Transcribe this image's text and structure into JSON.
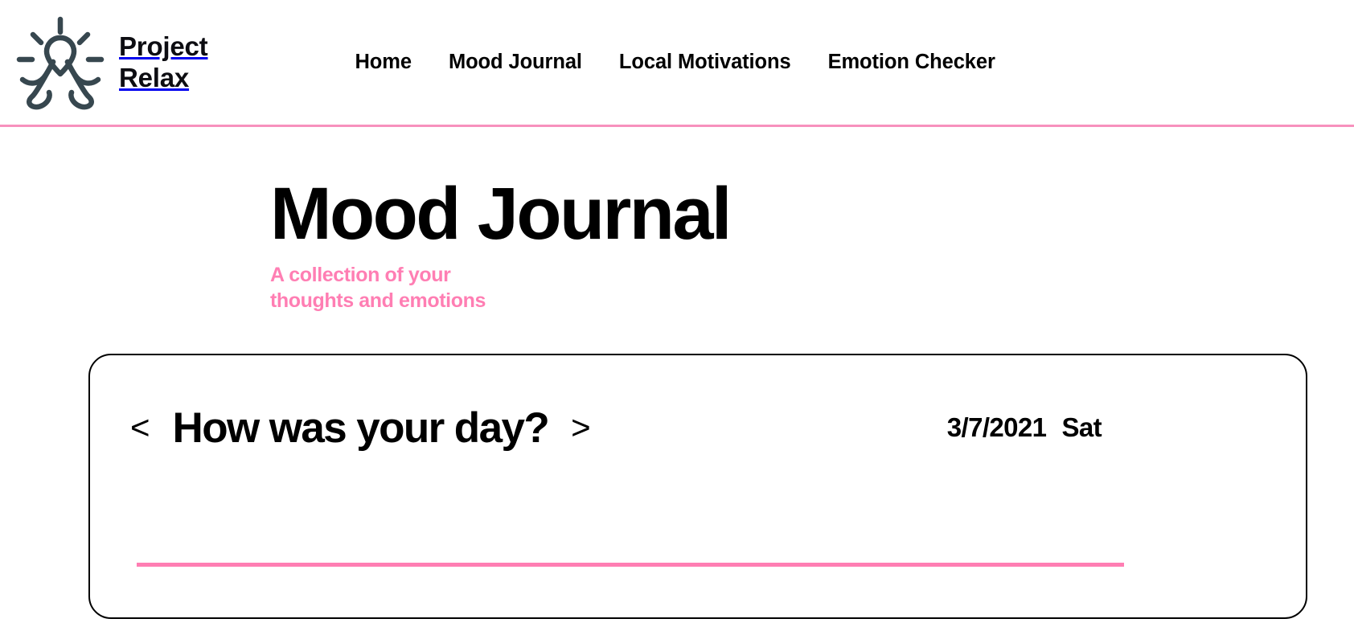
{
  "header": {
    "logo_icon": "meditation-figure-icon",
    "brand_name": "Project\nRelax",
    "nav": [
      {
        "label": "Home",
        "name": "nav-link-home"
      },
      {
        "label": "Mood Journal",
        "name": "nav-link-mood-journal"
      },
      {
        "label": "Local Motivations",
        "name": "nav-link-local-motivations"
      },
      {
        "label": "Emotion Checker",
        "name": "nav-link-emotion-checker"
      }
    ],
    "border_color": "#F791BD"
  },
  "hero": {
    "title": "Mood Journal",
    "subtitle": "A collection of your\nthoughts and emotions",
    "subtitle_color": "#FF7EB3"
  },
  "journal_card": {
    "prev_arrow": "<",
    "next_arrow": ">",
    "prompt": "How was your day?",
    "date": "3/7/2021",
    "weekday": "Sat",
    "divider_color": "#FF7EB3",
    "border_color": "#000000"
  }
}
